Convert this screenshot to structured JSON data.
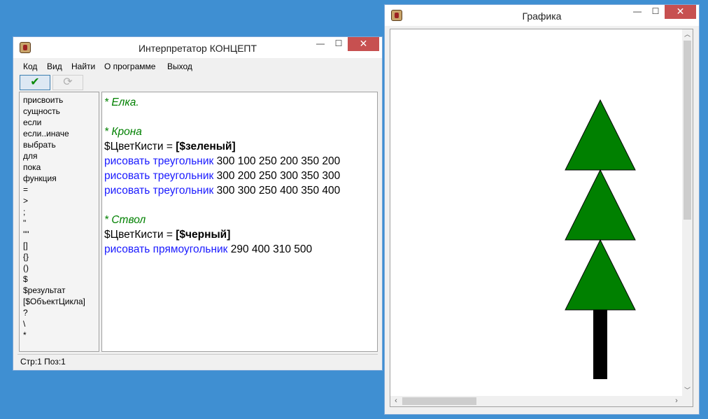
{
  "interpreter": {
    "title": "Интерпретатор КОНЦЕПТ",
    "controls": {
      "minimize": "—",
      "maximize": "☐",
      "close": "✕"
    },
    "menu": [
      "Код",
      "Вид",
      "Найти",
      "О программе",
      "Выход"
    ],
    "toolbar": {
      "run_icon": "checkmark-icon",
      "refresh_icon": "refresh-icon",
      "run_glyph": "✔",
      "refresh_glyph": "⟳"
    },
    "keywords": [
      "присвоить",
      "сущность",
      "если",
      "если..иначе",
      "выбрать",
      "для",
      "пока",
      "функция",
      "=",
      ">",
      ";",
      "\"",
      "\"\"",
      "[]",
      "{}",
      "()",
      "$",
      "$результат",
      "[$ОбъектЦикла]",
      "?",
      "\\",
      "*"
    ],
    "code": {
      "line1": "* Елка.",
      "line3": "* Крона",
      "line4_var": "$ЦветКисти = ",
      "line4_val": "[$зеленый]",
      "line5_cmd": "рисовать треугольник",
      "line5_args": " 300 100 250 200 350 200",
      "line6_cmd": "рисовать треугольник",
      "line6_args": " 300 200 250 300 350 300",
      "line7_cmd": "рисовать треугольник",
      "line7_args": " 300 300 250 400 350 400",
      "line9": "* Ствол",
      "line10_var": "$ЦветКисти = ",
      "line10_val": "[$черный]",
      "line11_cmd": "рисовать прямоугольник",
      "line11_args": " 290 400 310 500"
    },
    "status": "Стр:1 Поз:1"
  },
  "graphics": {
    "title": "Графика",
    "controls": {
      "minimize": "—",
      "maximize": "☐",
      "close": "✕"
    },
    "colors": {
      "crown": "#008000",
      "trunk": "#000000",
      "outline": "#000000"
    }
  }
}
